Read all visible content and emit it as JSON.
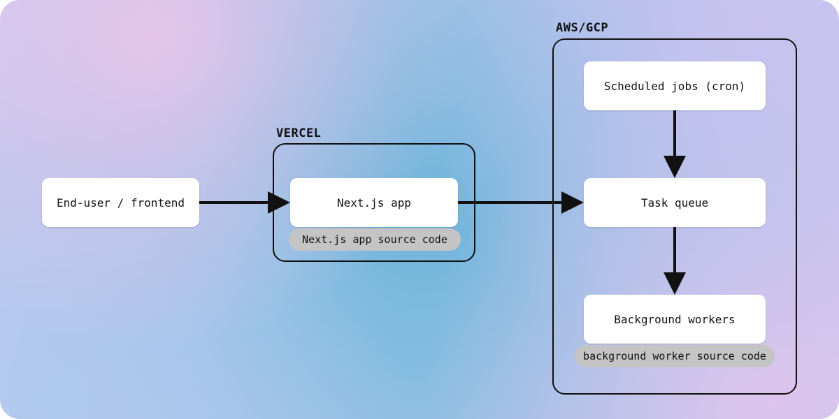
{
  "nodes": {
    "end_user": {
      "label": "End-user / frontend"
    },
    "nextjs_app": {
      "label": "Next.js app"
    },
    "scheduled_jobs": {
      "label": "Scheduled jobs (cron)"
    },
    "task_queue": {
      "label": "Task queue"
    },
    "background_workers": {
      "label": "Background workers"
    }
  },
  "groups": {
    "vercel": {
      "label": "VERCEL"
    },
    "aws_gcp": {
      "label": "AWS/GCP"
    }
  },
  "annotations": {
    "nextjs_source": {
      "label": "Next.js app source code"
    },
    "worker_source": {
      "label": "background worker source code"
    }
  },
  "edges": [
    {
      "from": "end_user",
      "to": "nextjs_app"
    },
    {
      "from": "nextjs_app",
      "to": "task_queue"
    },
    {
      "from": "scheduled_jobs",
      "to": "task_queue"
    },
    {
      "from": "task_queue",
      "to": "background_workers"
    }
  ]
}
